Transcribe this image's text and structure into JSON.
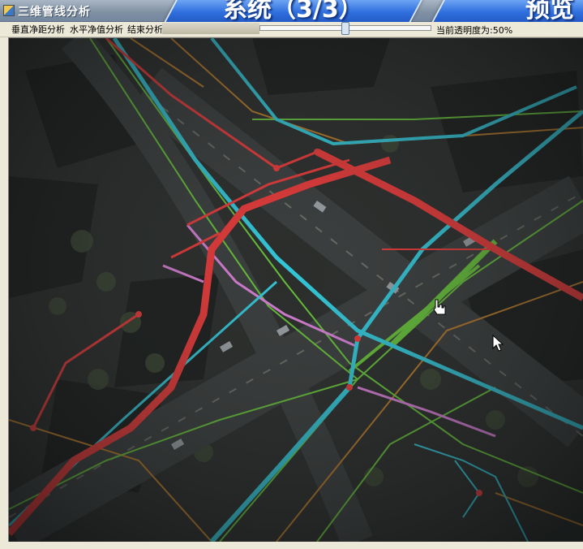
{
  "window": {
    "title": "三维管线分析"
  },
  "banner": {
    "left_text": "系统（3/3）",
    "right_text": "预览"
  },
  "menu": {
    "items": [
      {
        "label": "垂直净距分析"
      },
      {
        "label": "水平净值分析"
      },
      {
        "label": "结束分析"
      }
    ]
  },
  "toolbar": {
    "opacity_label": "当前透明度为:50%",
    "opacity_value": 0.5
  },
  "colors": {
    "water_pipe": "#33c7d9",
    "power_pipe": "#e83a3a",
    "telecom_pipe": "#67c23a",
    "gas_pipe": "#d77fd6",
    "drain_pipe": "#b87a2a"
  },
  "icons": {
    "hand_cursor": "hand-cursor-icon",
    "arrow_cursor": "arrow-cursor-icon"
  }
}
